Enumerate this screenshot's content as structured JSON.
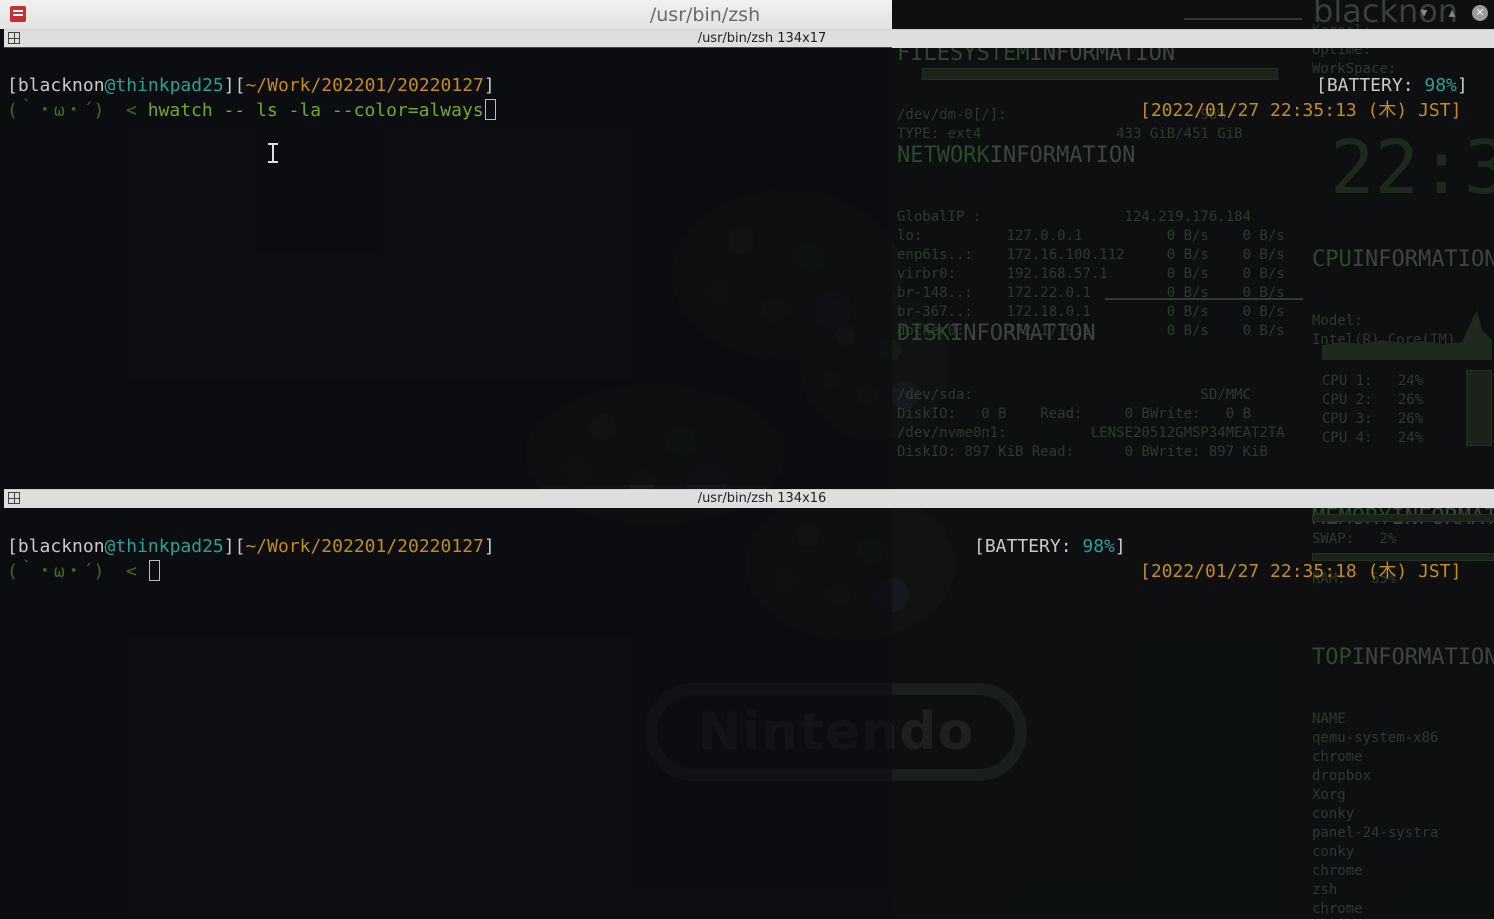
{
  "window": {
    "title": "/usr/bin/zsh",
    "controls": {
      "minimize": "▾",
      "maximize": "▴",
      "close": "✕"
    }
  },
  "panes": [
    {
      "header": "/usr/bin/zsh 134x17",
      "prompt": {
        "bracket_open": "[",
        "user": "blacknon",
        "at": "@",
        "host": "thinkpad25",
        "mid": "][",
        "path": "~/Work/202201/20220127",
        "bracket_close": "]",
        "battery_label": "[BATTERY: ",
        "battery_value": "98%",
        "battery_close": "]",
        "face": "(｀・ω・´)  < ",
        "command": "hwatch -- ls -la --color=always",
        "datetime": "[2022/01/27 22:35:13 (木) JST]"
      }
    },
    {
      "header": "/usr/bin/zsh 134x16",
      "prompt": {
        "bracket_open": "[",
        "user": "blacknon",
        "at": "@",
        "host": "thinkpad25",
        "mid": "][",
        "path": "~/Work/202201/20220127",
        "bracket_close": "]",
        "battery_label": "[BATTERY: ",
        "battery_value": "98%",
        "battery_close": "]",
        "face": "(｀・ω・´)  < ",
        "command": "",
        "datetime": "[2022/01/27 22:35:18 (木) JST]"
      }
    }
  ],
  "wallpaper": {
    "logo_text": "Nintendo",
    "conky_user": "blacknon",
    "clock": "22:3",
    "filesystem": {
      "head_a": "FILESYSTEM",
      "head_b": "INFORMATION",
      "lines": "/dev/dm-0[/]:                       96%\nTYPE: ext4                433 GiB/451 GiB"
    },
    "network": {
      "head_a": "NETWORK",
      "head_b": "INFORMATION",
      "lines": "GlobalIP :                 124.219.176.184\nlo:          127.0.0.1          0 B/s    0 B/s\nenp61s..:    172.16.100.112     0 B/s    0 B/s\nvirbr0:      192.168.57.1       0 B/s    0 B/s\nbr-148..:    172.22.0.1         0 B/s    0 B/s\nbr-367..:    172.18.0.1         0 B/s    0 B/s\ndocker0:     172.17.0.1         0 B/s    0 B/s"
    },
    "disk": {
      "head_a": "DISK",
      "head_b": "INFORMATION",
      "lines": "/dev/sda:                           SD/MMC\nDiskIO:   0 B    Read:     0 BWrite:   0 B\n/dev/nvme0n1:          LENSE20512GMSP34MEAT2TA\nDiskIO: 897 KiB Read:      0 BWrite: 897 KiB"
    },
    "system": {
      "lines": "Kernel:\nUptime:\nWorkSpace:"
    },
    "cpu": {
      "head_a": "CPU",
      "head_b": "INFORMATION",
      "lines": "Model:\nIntel(R) Core(TM) i7",
      "cores": "CPU 1:   24%\nCPU 2:   26%\nCPU 3:   26%\nCPU 4:   24%"
    },
    "memory": {
      "head_a": "MEMORY",
      "head_b": "INFORMAT",
      "ram": "RAM:   55%",
      "swap": "SWAP:   2%"
    },
    "top": {
      "head_a": "TOP",
      "head_b": "INFORMATION",
      "lines": "NAME\nqemu-system-x86\nchrome\ndropbox\nXorg\nconky\npanel-24-systra\nconky\nchrome\nzsh\nchrome"
    }
  }
}
